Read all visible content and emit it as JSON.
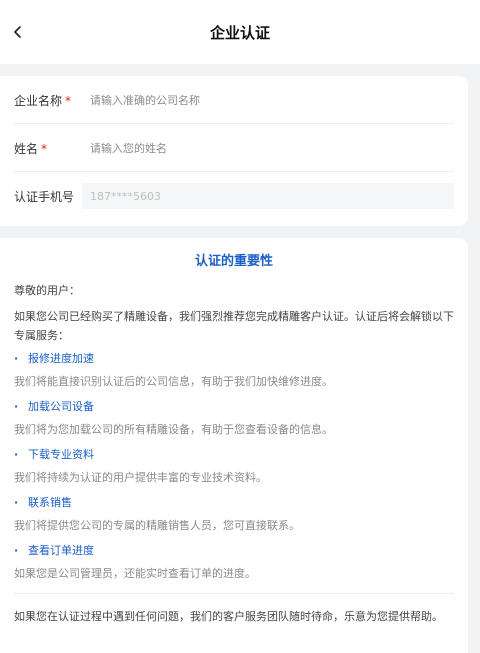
{
  "header": {
    "title": "企业认证"
  },
  "form": {
    "company": {
      "label": "企业名称",
      "required": "*",
      "placeholder": "请输入准确的公司名称"
    },
    "name": {
      "label": "姓名",
      "required": "*",
      "placeholder": "请输入您的姓名"
    },
    "phone": {
      "label": "认证手机号",
      "value": "187****5603"
    }
  },
  "info": {
    "title": "认证的重要性",
    "greeting": "尊敬的用户：",
    "intro": "如果您公司已经购买了精雕设备，我们强烈推荐您完成精雕客户认证。认证后将会解锁以下专属服务：",
    "bullet": "·",
    "features": [
      {
        "title": "报修进度加速",
        "desc": "我们将能直接识别认证后的公司信息，有助于我们加快维修进度。"
      },
      {
        "title": "加载公司设备",
        "desc": "我们将为您加载公司的所有精雕设备，有助于您查看设备的信息。"
      },
      {
        "title": "下载专业资料",
        "desc": "我们将持续为认证的用户提供丰富的专业技术资料。"
      },
      {
        "title": "联系销售",
        "desc": "我们将提供您公司的专属的精雕销售人员，您可直接联系。"
      },
      {
        "title": "查看订单进度",
        "desc": "如果您是公司管理员，还能实时查看订单的进度。"
      }
    ],
    "footer": "如果您在认证过程中遇到任何问题，我们的客户服务团队随时待命，乐意为您提供帮助。"
  },
  "colors": {
    "accent": "#1a5fc6",
    "required": "#e02020",
    "background": "#f2f3f5"
  }
}
